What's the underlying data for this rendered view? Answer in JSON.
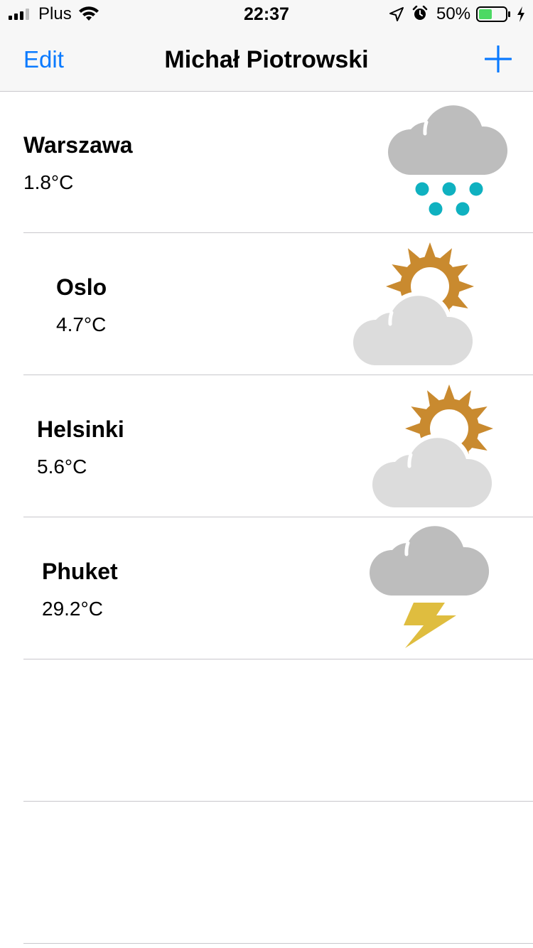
{
  "status_bar": {
    "carrier": "Plus",
    "time": "22:37",
    "battery_percent": "50%",
    "battery_level": 0.5,
    "icons": [
      "signal-icon",
      "wifi-icon",
      "location-icon",
      "alarm-icon",
      "battery-icon",
      "charging-bolt-icon"
    ]
  },
  "nav": {
    "edit_label": "Edit",
    "title": "Michał Piotrowski",
    "add_icon": "plus-icon"
  },
  "rows": [
    {
      "city": "Warszawa",
      "temp": "1.8°C",
      "icon": "cloud-snow-icon"
    },
    {
      "city": "Oslo",
      "temp": "4.7°C",
      "icon": "sun-behind-cloud-icon"
    },
    {
      "city": "Helsinki",
      "temp": "5.6°C",
      "icon": "sun-behind-cloud-icon"
    },
    {
      "city": "Phuket",
      "temp": "29.2°C",
      "icon": "cloud-lightning-icon"
    }
  ],
  "colors": {
    "accent": "#0a7aff",
    "cloud_dark": "#bdbdbd",
    "cloud_light": "#dcdcdc",
    "sun": "#c98a2f",
    "snow": "#0fb1c0",
    "lightning": "#dfbd3f",
    "battery_fill": "#4cd964"
  }
}
